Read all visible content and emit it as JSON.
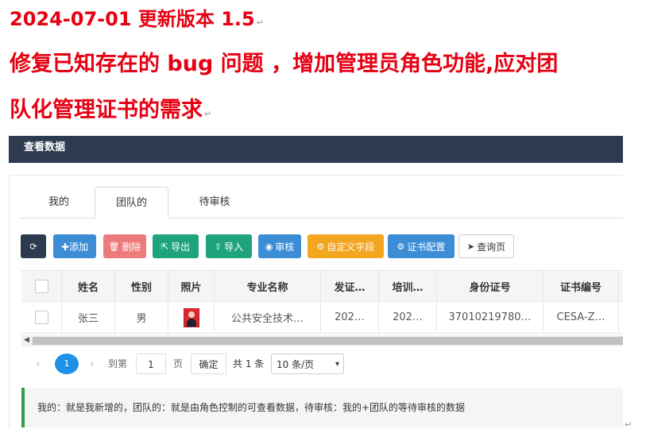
{
  "doc": {
    "line1": "2024-07-01 更新版本 1.5",
    "line2": "修复已知存在的 bug 问题 ，增加管理员角色功能,应对团",
    "line3": "队化管理证书的需求",
    "para_mark": "↵"
  },
  "panel": {
    "title": "查看数据"
  },
  "tabs": [
    {
      "label": "我的"
    },
    {
      "label": "团队的"
    },
    {
      "label": "待审核"
    }
  ],
  "active_tab": "团队的",
  "toolbar": {
    "refresh_icon": "⟳",
    "add_label": "✚添加",
    "delete_label": "删除",
    "delete_icon": "🗑",
    "export_label": "导出",
    "export_icon": "⇱",
    "import_label": "导入",
    "import_icon": "⇧",
    "review_label": "审核",
    "review_icon": "◉",
    "custom_label": "自定义字段",
    "custom_icon": "⚙",
    "cert_label": "证书配置",
    "cert_icon": "⚙",
    "query_label": "查询页",
    "query_icon": "➤"
  },
  "table": {
    "headers": [
      "姓名",
      "性别",
      "照片",
      "专业名称",
      "发证…",
      "培训…",
      "身份证号",
      "证书编号"
    ],
    "rows": [
      {
        "name": "张三",
        "gender": "男",
        "major": "公共安全技术…",
        "issue": "202…",
        "train": "202…",
        "id": "37010219780…",
        "cert": "CESA-Z…"
      }
    ]
  },
  "pager": {
    "prev": "‹",
    "current": "1",
    "next": "›",
    "goto_label": "到第",
    "page_input": "1",
    "page_unit": "页",
    "confirm": "确定",
    "total": "共 1 条",
    "page_size": "10 条/页",
    "caret": "▾"
  },
  "note": "我的：就是我新增的，团队的：就是由角色控制的可查看数据，待审核：我的+团队的等待审核的数据",
  "colors": {
    "accent_red": "#e60012",
    "header_bg": "#2c3b4f",
    "primary": "#3c8dd6",
    "success": "#1fa37c",
    "danger": "#ee7b7b",
    "warning": "#f3a620",
    "note_border": "#2f9d4e"
  }
}
